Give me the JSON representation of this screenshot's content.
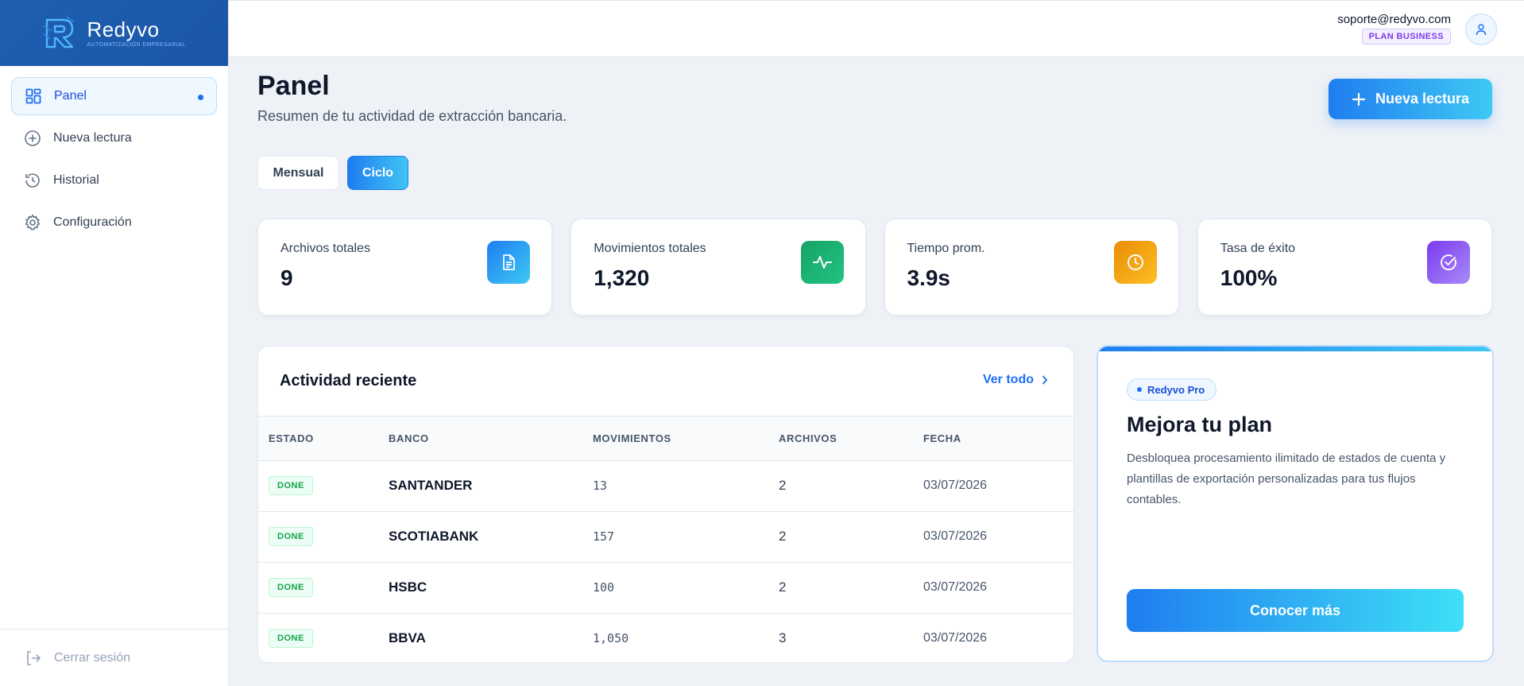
{
  "brand": {
    "name": "Redyvo",
    "tagline": "AUTOMATIZACIÓN EMPRESARIAL"
  },
  "sidebar": {
    "items": [
      {
        "label": "Panel",
        "icon": "grid-icon",
        "active": true
      },
      {
        "label": "Nueva lectura",
        "icon": "plus-circle-icon",
        "active": false
      },
      {
        "label": "Historial",
        "icon": "history-icon",
        "active": false
      },
      {
        "label": "Configuración",
        "icon": "gear-icon",
        "active": false
      }
    ],
    "logout_label": "Cerrar sesión"
  },
  "header": {
    "email": "soporte@redyvo.com",
    "plan": "PLAN BUSINESS"
  },
  "page": {
    "title": "Panel",
    "subtitle": "Resumen de tu actividad de extracción bancaria.",
    "new_button": "Nueva lectura"
  },
  "toggle": {
    "options": [
      "Mensual",
      "Ciclo"
    ],
    "selected": "Ciclo"
  },
  "stats": [
    {
      "label": "Archivos totales",
      "value": "9",
      "icon": "document-icon",
      "color": "#1f7df0"
    },
    {
      "label": "Movimientos totales",
      "value": "1,320",
      "icon": "activity-icon",
      "color": "#16a366"
    },
    {
      "label": "Tiempo prom.",
      "value": "3.9s",
      "icon": "clock-icon",
      "color": "#f59e0b"
    },
    {
      "label": "Tasa de éxito",
      "value": "100%",
      "icon": "check-circle-icon",
      "color": "#8b5cf6"
    }
  ],
  "activity": {
    "title": "Actividad reciente",
    "see_all": "Ver todo",
    "columns": [
      "ESTADO",
      "BANCO",
      "MOVIMIENTOS",
      "ARCHIVOS",
      "FECHA"
    ],
    "rows": [
      {
        "status": "DONE",
        "bank": "SANTANDER",
        "movements": "13",
        "files": "2",
        "date": "03/07/2026"
      },
      {
        "status": "DONE",
        "bank": "SCOTIABANK",
        "movements": "157",
        "files": "2",
        "date": "03/07/2026"
      },
      {
        "status": "DONE",
        "bank": "HSBC",
        "movements": "100",
        "files": "2",
        "date": "03/07/2026"
      },
      {
        "status": "DONE",
        "bank": "BBVA",
        "movements": "1,050",
        "files": "3",
        "date": "03/07/2026"
      }
    ]
  },
  "upgrade": {
    "chip": "Redyvo Pro",
    "title": "Mejora tu plan",
    "description": "Desbloquea procesamiento ilimitado de estados de cuenta y plantillas de exportación personalizadas para tus flujos contables.",
    "button": "Conocer más"
  },
  "colors": {
    "accent": "#1f7df0",
    "accent_end": "#3ec9f4",
    "brand_bg": "#1e5fb0",
    "success": "#16a34a",
    "plan": "#7c3aed"
  }
}
